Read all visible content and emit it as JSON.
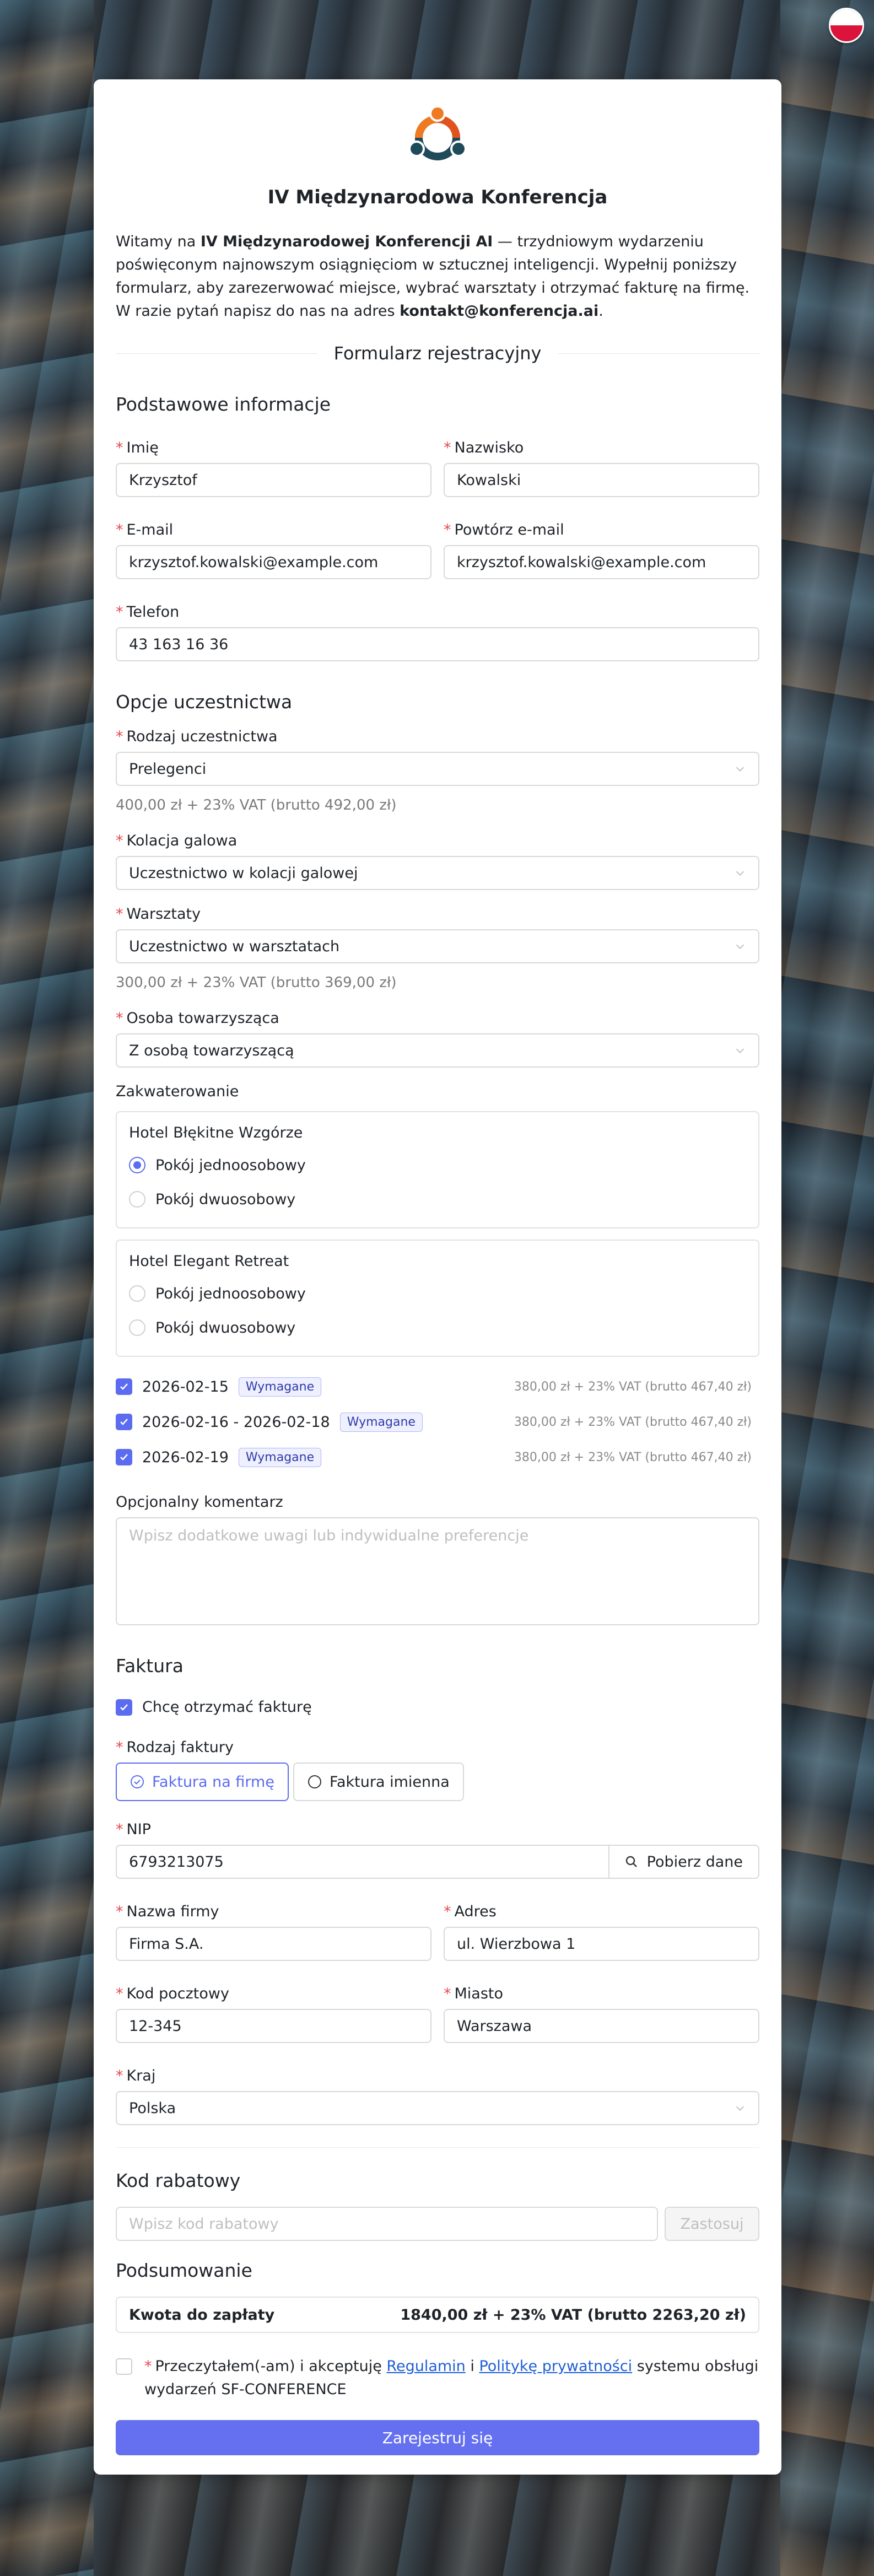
{
  "header": {
    "title": "IV Międzynarodowa Konferencja",
    "intro_pre": "Witamy na ",
    "intro_bold": "IV Międzynarodowej Konferencji AI",
    "intro_mid": " — trzydniowym wydarzeniu poświęconym najnowszym osiągnięciom w sztucznej inteligencji. Wypełnij poniższy formularz, aby zarezerwować miejsce, wybrać warsztaty i otrzymać fakturę na firmę. W razie pytań napisz do nas na adres ",
    "intro_email": "kontakt@konferencja.ai",
    "intro_end": ".",
    "form_title": "Formularz rejestracyjny"
  },
  "basic": {
    "title": "Podstawowe informacje",
    "first_name_label": "Imię",
    "first_name": "Krzysztof",
    "last_name_label": "Nazwisko",
    "last_name": "Kowalski",
    "email_label": "E-mail",
    "email": "krzysztof.kowalski@example.com",
    "email_repeat_label": "Powtórz e-mail",
    "email_repeat": "krzysztof.kowalski@example.com",
    "phone_label": "Telefon",
    "phone": "43 163 16 36"
  },
  "participation": {
    "title": "Opcje uczestnictwa",
    "type_label": "Rodzaj uczestnictwa",
    "type_value": "Prelegenci",
    "type_price": "400,00 zł + 23% VAT (brutto 492,00 zł)",
    "gala_label": "Kolacja galowa",
    "gala_value": "Uczestnictwo w kolacji galowej",
    "workshops_label": "Warsztaty",
    "workshops_value": "Uczestnictwo w warsztatach",
    "workshops_price": "300,00 zł + 23% VAT (brutto 369,00 zł)",
    "companion_label": "Osoba towarzysząca",
    "companion_value": "Z osobą towarzyszącą",
    "accommodation_label": "Zakwaterowanie",
    "hotels": [
      {
        "name": "Hotel Błękitne Wzgórze",
        "options": [
          {
            "label": "Pokój jednoosobowy",
            "selected": true
          },
          {
            "label": "Pokój dwuosobowy",
            "selected": false
          }
        ]
      },
      {
        "name": "Hotel Elegant Retreat",
        "options": [
          {
            "label": "Pokój jednoosobowy",
            "selected": false
          },
          {
            "label": "Pokój dwuosobowy",
            "selected": false
          }
        ]
      }
    ],
    "dates": [
      {
        "label": "2026-02-15",
        "tag": "Wymagane",
        "price": "380,00 zł + 23% VAT (brutto 467,40 zł)"
      },
      {
        "label": "2026-02-16 - 2026-02-18",
        "tag": "Wymagane",
        "price": "380,00 zł + 23% VAT (brutto 467,40 zł)"
      },
      {
        "label": "2026-02-19",
        "tag": "Wymagane",
        "price": "380,00 zł + 23% VAT (brutto 467,40 zł)"
      }
    ],
    "comment_label": "Opcjonalny komentarz",
    "comment_placeholder": "Wpisz dodatkowe uwagi lub indywidualne preferencje"
  },
  "invoice": {
    "title": "Faktura",
    "want_invoice": "Chcę otrzymać fakturę",
    "type_label": "Rodzaj faktury",
    "type_company": "Faktura na firmę",
    "type_personal": "Faktura imienna",
    "nip_label": "NIP",
    "nip": "6793213075",
    "fetch_label": "Pobierz dane",
    "company_label": "Nazwa firmy",
    "company": "Firma S.A.",
    "address_label": "Adres",
    "address": "ul. Wierzbowa 1",
    "zip_label": "Kod pocztowy",
    "zip": "12-345",
    "city_label": "Miasto",
    "city": "Warszawa",
    "country_label": "Kraj",
    "country": "Polska"
  },
  "discount": {
    "title": "Kod rabatowy",
    "placeholder": "Wpisz kod rabatowy",
    "apply": "Zastosuj"
  },
  "summary": {
    "title": "Podsumowanie",
    "total_label": "Kwota do zapłaty",
    "total_value": "1840,00 zł + 23% VAT (brutto 2263,20 zł)",
    "consent_pre": "Przeczytałem(-am) i akceptuję ",
    "consent_link1": "Regulamin",
    "consent_mid": " i ",
    "consent_link2": "Politykę prywatności",
    "consent_post": " systemu obsługi wydarzeń SF-CONFERENCE",
    "submit": "Zarejestruj się"
  },
  "colors": {
    "accent": "#6470f0",
    "required": "#e5484d",
    "logo_orange": "#f07a22",
    "logo_teal": "#1e4a5a"
  }
}
